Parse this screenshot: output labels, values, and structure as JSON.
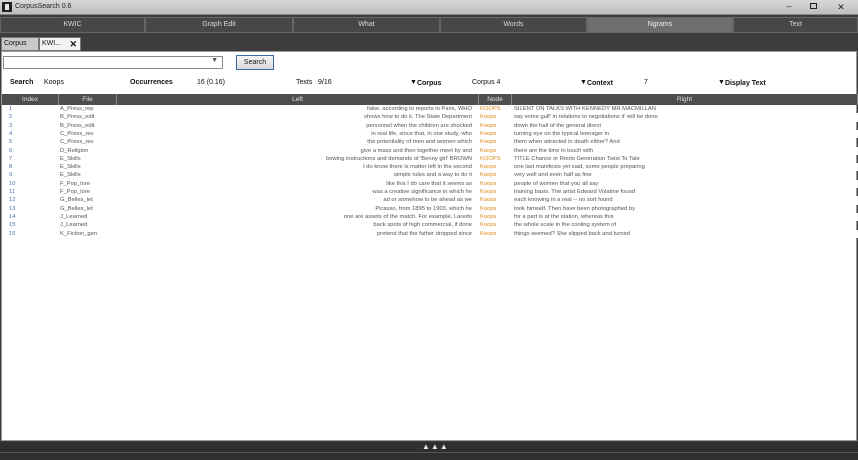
{
  "window": {
    "title": "CorpusSearch 0.6"
  },
  "nav": [
    "KWIC",
    "Graph Edit",
    "What",
    "Words",
    "Ngrams",
    "Text"
  ],
  "active_nav": 4,
  "doc_tabs": [
    {
      "label": "Corpus"
    },
    {
      "label": "KWI..."
    }
  ],
  "search": {
    "value": "",
    "button": "Search"
  },
  "info": {
    "search_label": "Search",
    "search_value": "Koops",
    "occ_label": "Occurrences",
    "occ_value": "16 (0.16)",
    "texts_label": "Texts",
    "texts_value": "9/16",
    "corpus_label": "Corpus",
    "corpus_value": "Corpus 4",
    "context_label": "Context",
    "context_value": "7",
    "display_label": "Display Text"
  },
  "table": {
    "headers": [
      "Index",
      "File",
      "Left",
      "Node",
      "Right"
    ],
    "rows": [
      {
        "index": "1",
        "file": "A_Press_rep",
        "left": "false, according to reports in Paris, WHO",
        "node": "KOOPS",
        "right": "SILENT ON TALKS WITH KENNEDY MR MACMILLAN"
      },
      {
        "index": "2",
        "file": "B_Press_edit",
        "left": "shows how to do it. The State Department",
        "node": "Koops",
        "right": "say some gulf' in relations to negotiations it' will be done"
      },
      {
        "index": "3",
        "file": "B_Press_edit",
        "left": "personnel when the children are shocked",
        "node": "Koops",
        "right": "down the hall of the general direct"
      },
      {
        "index": "4",
        "file": "C_Press_rev",
        "left": "in real life, since that, in one study, who",
        "node": "Koops",
        "right": "turning eye on the typical teenager in"
      },
      {
        "index": "5",
        "file": "C_Press_rev",
        "left": "the potentiality of men and women which",
        "node": "Koops",
        "right": "them when attracted in death either? And"
      },
      {
        "index": "6",
        "file": "D_Religion",
        "left": "give a mass and then together meet by and",
        "node": "Koops",
        "right": "there are the time in touch with"
      },
      {
        "index": "7",
        "file": "E_Skills",
        "left": "bowing instructions and demands of 'Benny girl' BROWN",
        "node": "KOOPS",
        "right": "TITLE Chance or Roots Generation Twist To Tale"
      },
      {
        "index": "8",
        "file": "E_Skills",
        "left": "I do know there is matter left in the second",
        "node": "Koops",
        "right": "one last manifests yet said, some people preparing"
      },
      {
        "index": "9",
        "file": "E_Skills",
        "left": "simple rules and a way to do it",
        "node": "Koops",
        "right": "very well and even half as fine"
      },
      {
        "index": "10",
        "file": "F_Pop_lore",
        "left": "like this I do care that it seems as",
        "node": "Koops",
        "right": "people of women that you all say"
      },
      {
        "index": "11",
        "file": "F_Pop_lore",
        "left": "was a creative significance in which he",
        "node": "Koops",
        "right": "training basis. The artist Edward Volatine found"
      },
      {
        "index": "12",
        "file": "G_Belles_let",
        "left": "ad or somehow to be ahead as we",
        "node": "Koops",
        "right": "each knowing in a real -- no sort found"
      },
      {
        "index": "13",
        "file": "G_Belles_let",
        "left": "Picasso, from 1895 to 1903, which he",
        "node": "Koops",
        "right": "took himself. Then have been photographed by"
      },
      {
        "index": "14",
        "file": "J_Learned",
        "left": "one are assets of the match. For example, Laredo",
        "node": "Koops",
        "right": "for a part is at the station, whereas this"
      },
      {
        "index": "15",
        "file": "J_Learned",
        "left": "back spots of high commercial, if done",
        "node": "Koops",
        "right": "the whole scale in the cooling system of"
      },
      {
        "index": "16",
        "file": "K_Fiction_gen",
        "left": "pretend that the father dropped since",
        "node": "Koops",
        "right": "things seemed? She slipped back and turned"
      }
    ]
  },
  "footer": {
    "collapse": "▲▲▲"
  }
}
